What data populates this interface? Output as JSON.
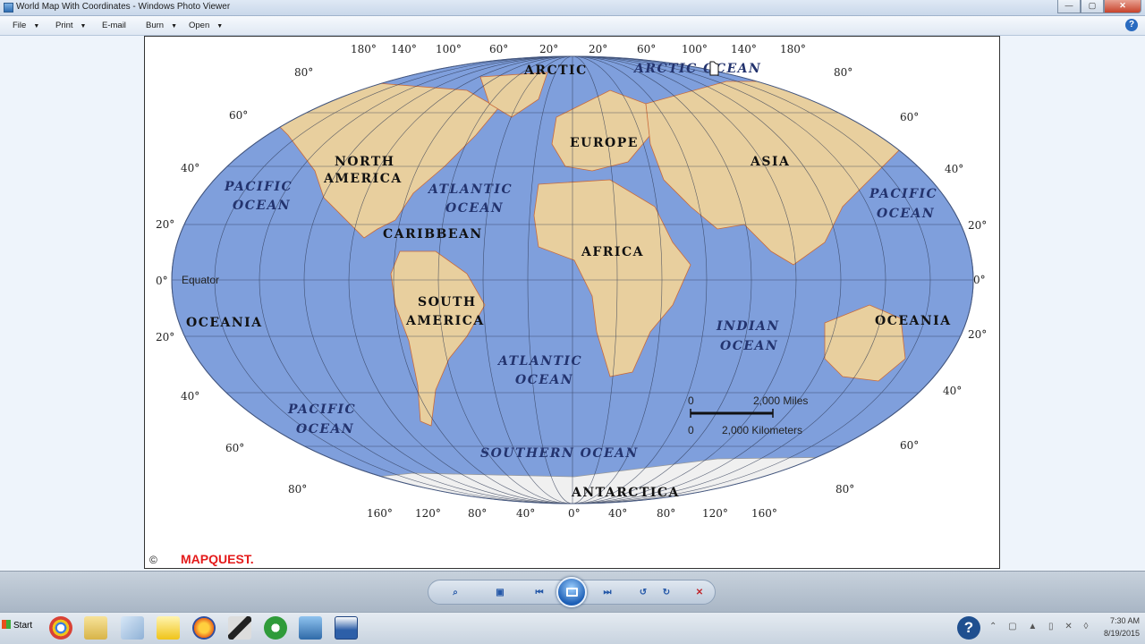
{
  "window": {
    "title": "World Map With Coordinates - Windows Photo Viewer",
    "minimize": "—",
    "maximize": "▢",
    "close": "✕"
  },
  "menu": {
    "file": "File",
    "print": "Print",
    "email": "E-mail",
    "burn": "Burn",
    "open": "Open",
    "help": "?"
  },
  "map": {
    "top_longitudes": [
      "180°",
      "140°",
      "100°",
      "60°",
      "20°",
      "20°",
      "60°",
      "100°",
      "140°",
      "180°"
    ],
    "bottom_longitudes": [
      "160°",
      "120°",
      "80°",
      "40°",
      "0°",
      "40°",
      "80°",
      "120°",
      "160°"
    ],
    "left_latitudes": [
      "80°",
      "60°",
      "40°",
      "20°",
      "0°",
      "20°",
      "40°",
      "60°",
      "80°"
    ],
    "right_latitudes": [
      "80°",
      "60°",
      "40°",
      "20°",
      "0°",
      "20°",
      "40°",
      "60°",
      "80°"
    ],
    "equator": "Equator",
    "continents": {
      "north_america_1": "NORTH",
      "north_america_2": "AMERICA",
      "south_america_1": "SOUTH",
      "south_america_2": "AMERICA",
      "europe": "EUROPE",
      "asia": "ASIA",
      "africa": "AFRICA",
      "oceania_left": "OCEANIA",
      "oceania_right": "OCEANIA",
      "antarctica": "ANTARCTICA",
      "caribbean": "CARIBBEAN",
      "arctic": "ARCTIC"
    },
    "oceans": {
      "arctic": "ARCTIC OCEAN",
      "pacific_nw_1": "PACIFIC",
      "pacific_nw_2": "OCEAN",
      "pacific_ne_1": "PACIFIC",
      "pacific_ne_2": "OCEAN",
      "pacific_sw_1": "PACIFIC",
      "pacific_sw_2": "OCEAN",
      "atlantic_n_1": "ATLANTIC",
      "atlantic_n_2": "OCEAN",
      "atlantic_s_1": "ATLANTIC",
      "atlantic_s_2": "OCEAN",
      "indian_1": "INDIAN",
      "indian_2": "OCEAN",
      "southern": "SOUTHERN OCEAN"
    },
    "scale": {
      "zero_miles": "0",
      "miles": "2,000 Miles",
      "zero_km": "0",
      "km": "2,000 Kilometers"
    },
    "copyright": "©",
    "logo": "MAPQUEST."
  },
  "taskbar": {
    "start": "Start",
    "help": "?",
    "time": "7:30 AM",
    "date": "8/19/2015"
  },
  "colors": {
    "ocean": "#7f9fdc",
    "land": "#e8cf9e",
    "border": "#c96a3a",
    "ice": "#f0f0f0"
  }
}
